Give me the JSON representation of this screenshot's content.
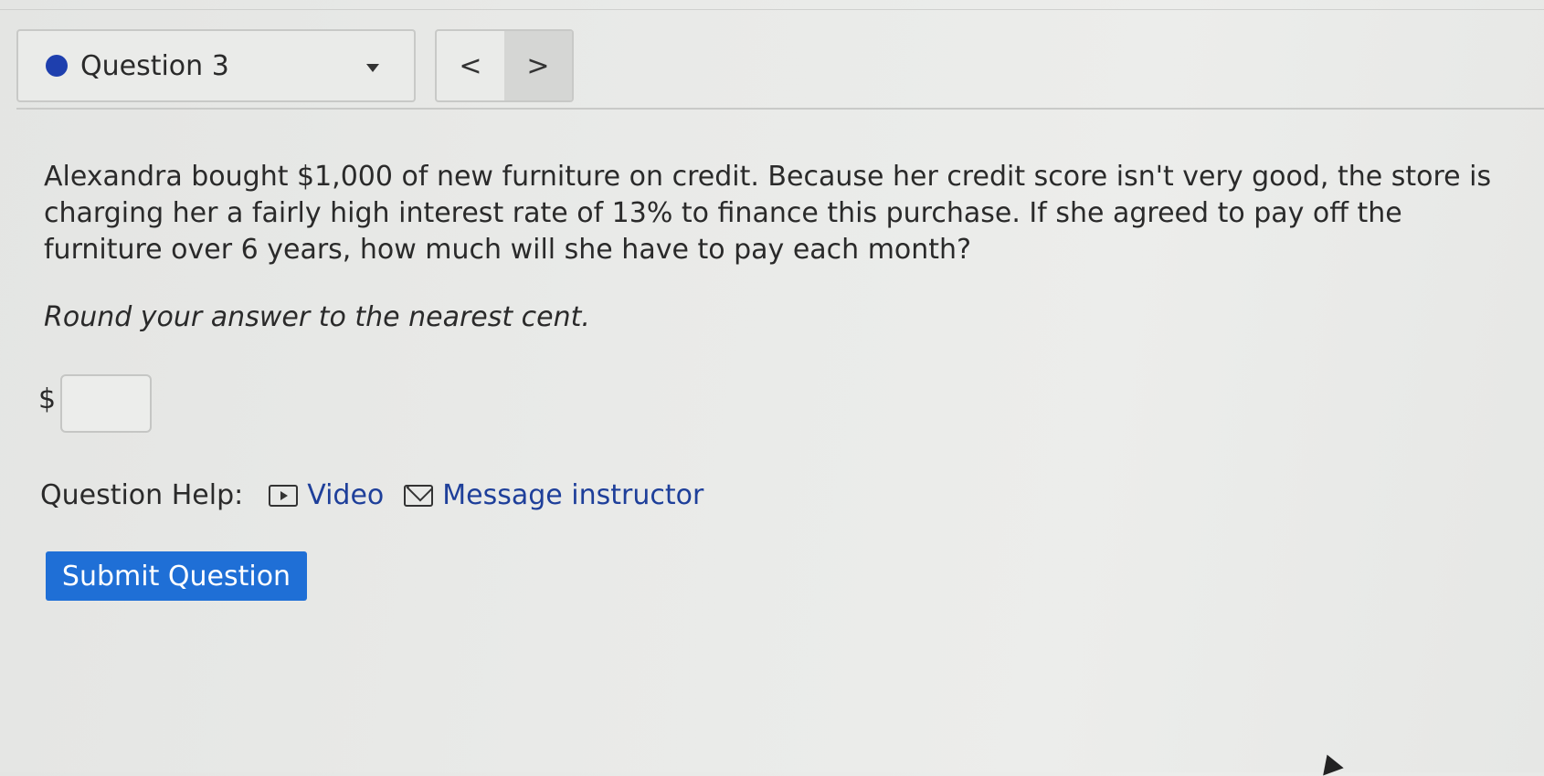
{
  "header": {
    "question_label": "Question 3",
    "status_color": "#1e3fae",
    "prev_label": "<",
    "next_label": ">"
  },
  "question": {
    "text": "Alexandra bought $1,000 of new furniture on credit. Because her credit score isn't very good, the store is charging her a fairly high interest rate of 13% to finance this purchase. If she agreed to pay off the furniture over 6 years, how much will she have to pay each month?",
    "instruction": "Round your answer to the nearest cent.",
    "currency_symbol": "$",
    "answer_value": ""
  },
  "help": {
    "label": "Question Help:",
    "video_label": "Video",
    "message_label": "Message instructor",
    "video_icon": "video-play-icon",
    "message_icon": "envelope-icon"
  },
  "actions": {
    "submit_label": "Submit Question",
    "submit_color": "#1f6fd6"
  }
}
